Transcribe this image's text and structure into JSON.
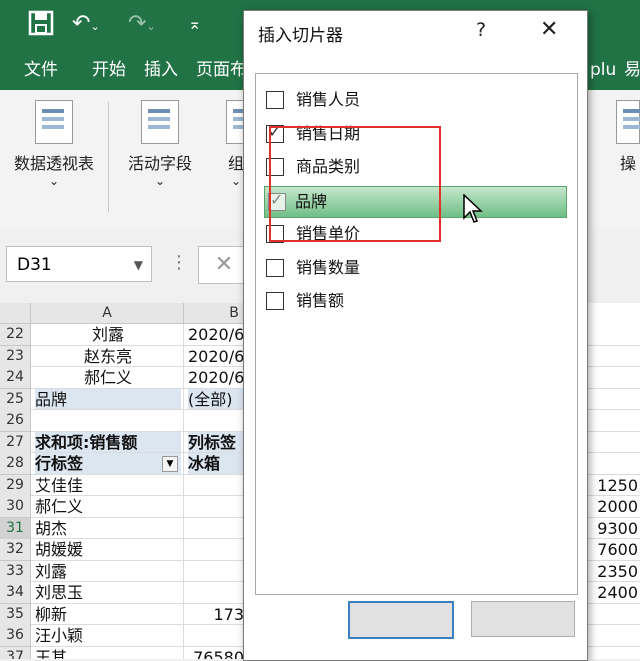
{
  "qat": {
    "save_icon": "save-icon",
    "undo_icon": "undo-icon",
    "redo_icon": "redo-icon",
    "customize_icon": "customize-qat-icon"
  },
  "tabs": [
    "文件",
    "开始",
    "插入",
    "页面布",
    "plu",
    "易"
  ],
  "ribbon": {
    "groups": [
      {
        "label": "数据透视表",
        "sub": "⌄"
      },
      {
        "label": "活动字段",
        "sub": "⌄"
      },
      {
        "label": "组",
        "sub": "⌄"
      },
      {
        "label": "操",
        "sub": ""
      }
    ]
  },
  "namebox": {
    "value": "D31"
  },
  "grid": {
    "col_headers": [
      "A",
      "B"
    ],
    "rows": [
      {
        "num": "22",
        "a": "刘露",
        "b": "2020/6"
      },
      {
        "num": "23",
        "a": "赵东亮",
        "b": "2020/6"
      },
      {
        "num": "24",
        "a": "郝仁义",
        "b": "2020/6"
      },
      {
        "num": "25",
        "a": "品牌",
        "b": "(全部)"
      },
      {
        "num": "26",
        "a": "",
        "b": ""
      },
      {
        "num": "27",
        "a": "求和项:销售额",
        "b": "列标签"
      },
      {
        "num": "28",
        "a": "行标签",
        "b": "冰箱"
      },
      {
        "num": "29",
        "a": "艾佳佳",
        "b": "",
        "r": "1250"
      },
      {
        "num": "30",
        "a": "郝仁义",
        "b": "",
        "r": "2000"
      },
      {
        "num": "31",
        "a": "胡杰",
        "b": "",
        "r": "9300"
      },
      {
        "num": "32",
        "a": "胡媛媛",
        "b": "",
        "r": "7600"
      },
      {
        "num": "33",
        "a": "刘露",
        "b": "",
        "r": "2350"
      },
      {
        "num": "34",
        "a": "刘思玉",
        "b": "",
        "r": "2400"
      },
      {
        "num": "35",
        "a": "柳新",
        "b": "173",
        "r": ""
      },
      {
        "num": "36",
        "a": "汪小颖",
        "b": "",
        "r": ""
      },
      {
        "num": "37",
        "a": "王其",
        "b": "76580",
        "r": ""
      }
    ]
  },
  "dialog": {
    "title": "插入切片器",
    "help": "?",
    "close": "✕",
    "items": [
      {
        "label": "销售人员",
        "checked": false
      },
      {
        "label": "销售日期",
        "checked": true
      },
      {
        "label": "商品类别",
        "checked": false
      },
      {
        "label": "品牌",
        "checked": true
      },
      {
        "label": "销售单价",
        "checked": false
      },
      {
        "label": "销售数量",
        "checked": false
      },
      {
        "label": "销售额",
        "checked": false
      }
    ],
    "ok_label": "",
    "cancel_label": ""
  },
  "colors": {
    "excel_green": "#217346",
    "highlight": "#6fbf86",
    "annotation_red": "#e0312b"
  }
}
